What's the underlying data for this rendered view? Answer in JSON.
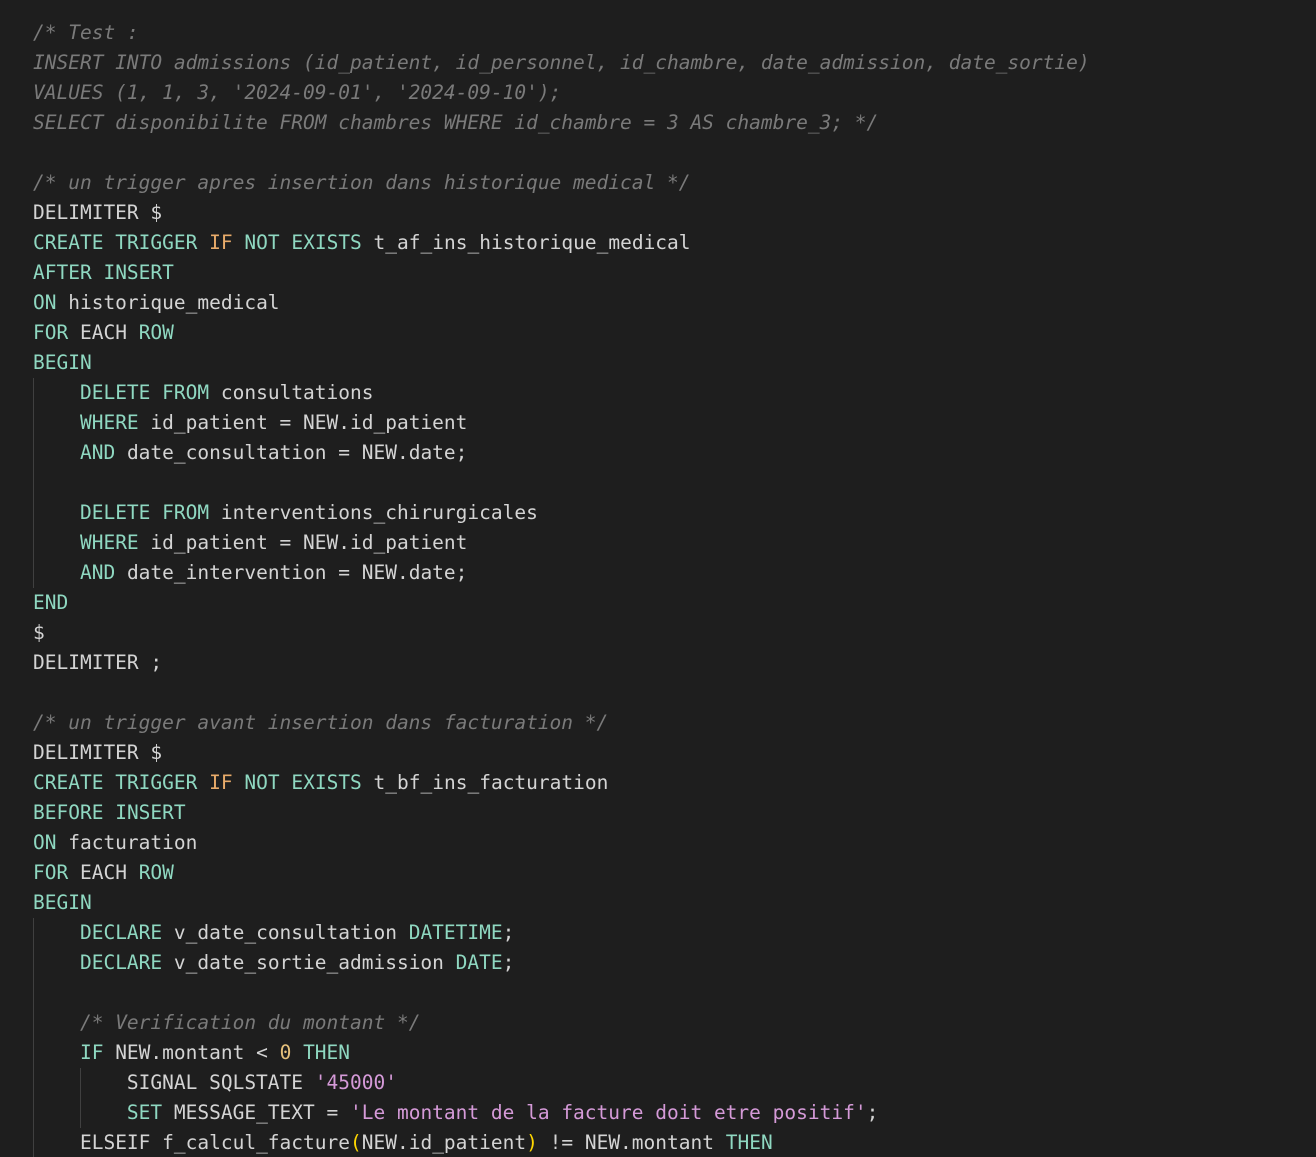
{
  "editor": {
    "lines": [
      {
        "indent": 0,
        "tokens": [
          {
            "t": "cmt",
            "v": "/* Test :"
          }
        ]
      },
      {
        "indent": 0,
        "tokens": [
          {
            "t": "cmt",
            "v": "INSERT INTO admissions (id_patient, id_personnel, id_chambre, date_admission, date_sortie)"
          }
        ]
      },
      {
        "indent": 0,
        "tokens": [
          {
            "t": "cmt",
            "v": "VALUES (1, 1, 3, '2024-09-01', '2024-09-10');"
          }
        ]
      },
      {
        "indent": 0,
        "tokens": [
          {
            "t": "cmt",
            "v": "SELECT disponibilite FROM chambres WHERE id_chambre = 3 AS chambre_3; */"
          }
        ]
      },
      {
        "indent": 0,
        "tokens": []
      },
      {
        "indent": 0,
        "tokens": [
          {
            "t": "cmt",
            "v": "/* un trigger apres insertion dans historique medical */"
          }
        ]
      },
      {
        "indent": 0,
        "tokens": [
          {
            "t": "id",
            "v": "DELIMITER $"
          }
        ]
      },
      {
        "indent": 0,
        "tokens": [
          {
            "t": "kw",
            "v": "CREATE"
          },
          {
            "t": "id",
            "v": " "
          },
          {
            "t": "kw",
            "v": "TRIGGER"
          },
          {
            "t": "id",
            "v": " "
          },
          {
            "t": "ctl",
            "v": "IF"
          },
          {
            "t": "id",
            "v": " "
          },
          {
            "t": "kw",
            "v": "NOT"
          },
          {
            "t": "id",
            "v": " "
          },
          {
            "t": "kw",
            "v": "EXISTS"
          },
          {
            "t": "id",
            "v": " t_af_ins_historique_medical"
          }
        ]
      },
      {
        "indent": 0,
        "tokens": [
          {
            "t": "kw",
            "v": "AFTER"
          },
          {
            "t": "id",
            "v": " "
          },
          {
            "t": "kw",
            "v": "INSERT"
          }
        ]
      },
      {
        "indent": 0,
        "tokens": [
          {
            "t": "kw",
            "v": "ON"
          },
          {
            "t": "id",
            "v": " historique_medical"
          }
        ]
      },
      {
        "indent": 0,
        "tokens": [
          {
            "t": "kw",
            "v": "FOR"
          },
          {
            "t": "id",
            "v": " EACH "
          },
          {
            "t": "kw",
            "v": "ROW"
          }
        ]
      },
      {
        "indent": 0,
        "tokens": [
          {
            "t": "kw",
            "v": "BEGIN"
          }
        ]
      },
      {
        "indent": 1,
        "tokens": [
          {
            "t": "kw",
            "v": "DELETE"
          },
          {
            "t": "id",
            "v": " "
          },
          {
            "t": "kw",
            "v": "FROM"
          },
          {
            "t": "id",
            "v": " consultations"
          }
        ]
      },
      {
        "indent": 1,
        "tokens": [
          {
            "t": "kw",
            "v": "WHERE"
          },
          {
            "t": "id",
            "v": " id_patient = NEW.id_patient"
          }
        ]
      },
      {
        "indent": 1,
        "tokens": [
          {
            "t": "kw",
            "v": "AND"
          },
          {
            "t": "id",
            "v": " date_consultation = NEW.date;"
          }
        ]
      },
      {
        "indent": 1,
        "tokens": []
      },
      {
        "indent": 1,
        "tokens": [
          {
            "t": "kw",
            "v": "DELETE"
          },
          {
            "t": "id",
            "v": " "
          },
          {
            "t": "kw",
            "v": "FROM"
          },
          {
            "t": "id",
            "v": " interventions_chirurgicales"
          }
        ]
      },
      {
        "indent": 1,
        "tokens": [
          {
            "t": "kw",
            "v": "WHERE"
          },
          {
            "t": "id",
            "v": " id_patient = NEW.id_patient"
          }
        ]
      },
      {
        "indent": 1,
        "tokens": [
          {
            "t": "kw",
            "v": "AND"
          },
          {
            "t": "id",
            "v": " date_intervention = NEW.date;"
          }
        ]
      },
      {
        "indent": 0,
        "tokens": [
          {
            "t": "kw",
            "v": "END"
          }
        ]
      },
      {
        "indent": 0,
        "tokens": [
          {
            "t": "id",
            "v": "$"
          }
        ]
      },
      {
        "indent": 0,
        "tokens": [
          {
            "t": "id",
            "v": "DELIMITER ;"
          }
        ]
      },
      {
        "indent": 0,
        "tokens": []
      },
      {
        "indent": 0,
        "tokens": [
          {
            "t": "cmt",
            "v": "/* un trigger avant insertion dans facturation */"
          }
        ]
      },
      {
        "indent": 0,
        "tokens": [
          {
            "t": "id",
            "v": "DELIMITER $"
          }
        ]
      },
      {
        "indent": 0,
        "tokens": [
          {
            "t": "kw",
            "v": "CREATE"
          },
          {
            "t": "id",
            "v": " "
          },
          {
            "t": "kw",
            "v": "TRIGGER"
          },
          {
            "t": "id",
            "v": " "
          },
          {
            "t": "ctl",
            "v": "IF"
          },
          {
            "t": "id",
            "v": " "
          },
          {
            "t": "kw",
            "v": "NOT"
          },
          {
            "t": "id",
            "v": " "
          },
          {
            "t": "kw",
            "v": "EXISTS"
          },
          {
            "t": "id",
            "v": " t_bf_ins_facturation"
          }
        ]
      },
      {
        "indent": 0,
        "tokens": [
          {
            "t": "kw",
            "v": "BEFORE"
          },
          {
            "t": "id",
            "v": " "
          },
          {
            "t": "kw",
            "v": "INSERT"
          }
        ]
      },
      {
        "indent": 0,
        "tokens": [
          {
            "t": "kw",
            "v": "ON"
          },
          {
            "t": "id",
            "v": " facturation"
          }
        ]
      },
      {
        "indent": 0,
        "tokens": [
          {
            "t": "kw",
            "v": "FOR"
          },
          {
            "t": "id",
            "v": " EACH "
          },
          {
            "t": "kw",
            "v": "ROW"
          }
        ]
      },
      {
        "indent": 0,
        "tokens": [
          {
            "t": "kw",
            "v": "BEGIN"
          }
        ]
      },
      {
        "indent": 1,
        "tokens": [
          {
            "t": "kw",
            "v": "DECLARE"
          },
          {
            "t": "id",
            "v": " v_date_consultation "
          },
          {
            "t": "kw",
            "v": "DATETIME"
          },
          {
            "t": "id",
            "v": ";"
          }
        ]
      },
      {
        "indent": 1,
        "tokens": [
          {
            "t": "kw",
            "v": "DECLARE"
          },
          {
            "t": "id",
            "v": " v_date_sortie_admission "
          },
          {
            "t": "kw",
            "v": "DATE"
          },
          {
            "t": "id",
            "v": ";"
          }
        ]
      },
      {
        "indent": 1,
        "tokens": []
      },
      {
        "indent": 1,
        "tokens": [
          {
            "t": "cmt",
            "v": "/* Verification du montant */"
          }
        ]
      },
      {
        "indent": 1,
        "tokens": [
          {
            "t": "kw",
            "v": "IF"
          },
          {
            "t": "id",
            "v": " NEW.montant < "
          },
          {
            "t": "num",
            "v": "0"
          },
          {
            "t": "id",
            "v": " "
          },
          {
            "t": "kw",
            "v": "THEN"
          }
        ]
      },
      {
        "indent": 2,
        "tokens": [
          {
            "t": "id",
            "v": "SIGNAL SQLSTATE "
          },
          {
            "t": "str",
            "v": "'45000'"
          }
        ]
      },
      {
        "indent": 2,
        "tokens": [
          {
            "t": "kw",
            "v": "SET"
          },
          {
            "t": "id",
            "v": " MESSAGE_TEXT = "
          },
          {
            "t": "str",
            "v": "'Le montant de la facture doit etre positif'"
          },
          {
            "t": "id",
            "v": ";"
          }
        ]
      },
      {
        "indent": 1,
        "tokens": [
          {
            "t": "id",
            "v": "ELSEIF f_calcul_facture"
          },
          {
            "t": "bracket",
            "v": "("
          },
          {
            "t": "id",
            "v": "NEW.id_patient"
          },
          {
            "t": "bracket",
            "v": ")"
          },
          {
            "t": "id",
            "v": " != NEW.montant "
          },
          {
            "t": "kw",
            "v": "THEN"
          }
        ]
      }
    ]
  }
}
